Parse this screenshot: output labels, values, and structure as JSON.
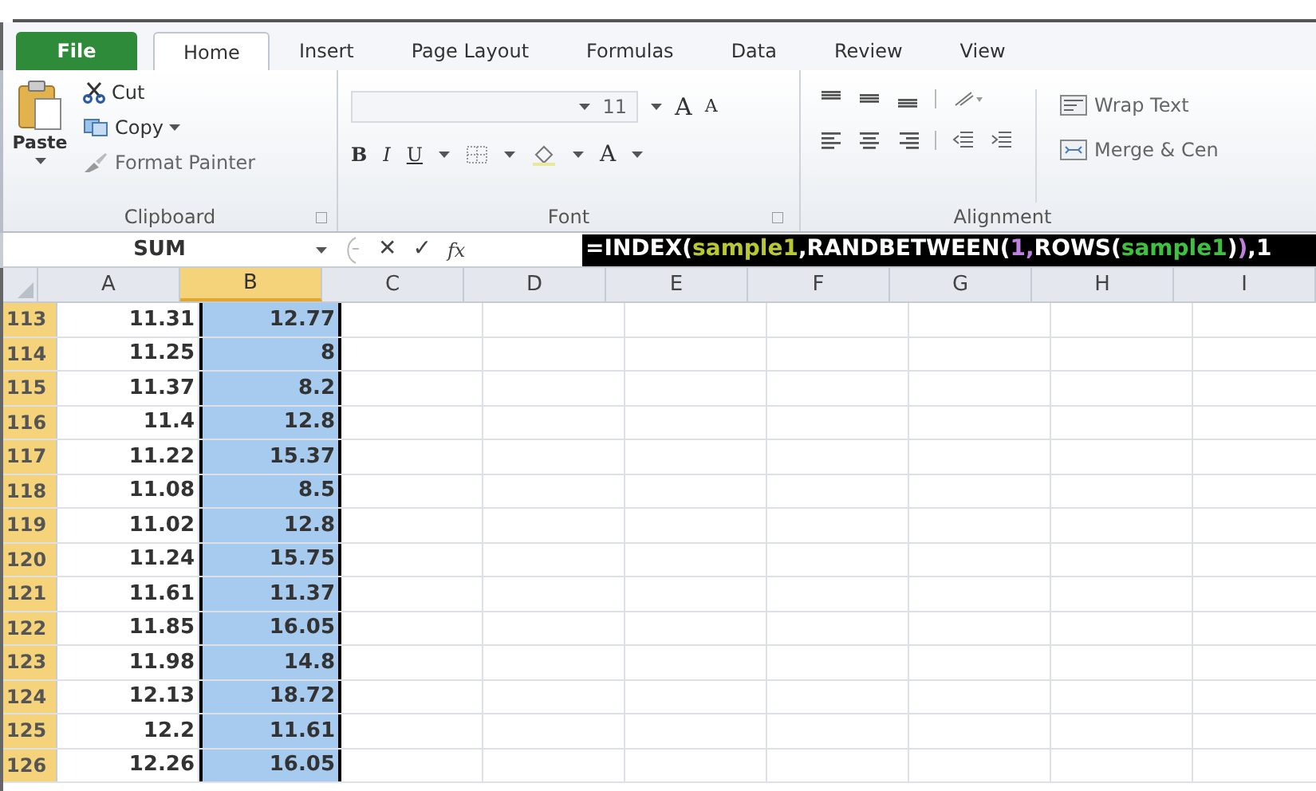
{
  "tabs": [
    {
      "label": "File",
      "kind": "file",
      "selected": false
    },
    {
      "label": "Home",
      "kind": "tab",
      "selected": true
    },
    {
      "label": "Insert",
      "kind": "tab",
      "selected": false
    },
    {
      "label": "Page Layout",
      "kind": "tab",
      "selected": false
    },
    {
      "label": "Formulas",
      "kind": "tab",
      "selected": false
    },
    {
      "label": "Data",
      "kind": "tab",
      "selected": false
    },
    {
      "label": "Review",
      "kind": "tab",
      "selected": false
    },
    {
      "label": "View",
      "kind": "tab",
      "selected": false
    }
  ],
  "clipboard": {
    "paste": "Paste",
    "cut": "Cut",
    "copy": "Copy",
    "format_painter": "Format Painter",
    "label": "Clipboard"
  },
  "font": {
    "size": "11",
    "bold": "B",
    "italic": "I",
    "underline": "U",
    "font_color": "A",
    "grow": "A",
    "shrink": "A",
    "label": "Font"
  },
  "alignment": {
    "wrap_text": "Wrap Text",
    "merge": "Merge & Cen",
    "label": "Alignment"
  },
  "formula_bar": {
    "name_box": "SUM",
    "cancel": "✕",
    "enter": "✓",
    "fx": "fx",
    "formula": [
      {
        "text": "=INDEX(",
        "kind": "plain"
      },
      {
        "text": "sample1",
        "kind": "range"
      },
      {
        "text": ",RANDBETWEEN(",
        "kind": "plain"
      },
      {
        "text": "1,",
        "kind": "nested"
      },
      {
        "text": "ROWS(",
        "kind": "plain"
      },
      {
        "text": "sample1",
        "kind": "inner"
      },
      {
        "text": ")",
        "kind": "plain"
      },
      {
        "text": ")",
        "kind": "nested"
      },
      {
        "text": ",1",
        "kind": "plain"
      }
    ]
  },
  "columns": [
    {
      "label": "A",
      "selected": false
    },
    {
      "label": "B",
      "selected": true
    },
    {
      "label": "C",
      "selected": false
    },
    {
      "label": "D",
      "selected": false
    },
    {
      "label": "E",
      "selected": false
    },
    {
      "label": "F",
      "selected": false
    },
    {
      "label": "G",
      "selected": false
    },
    {
      "label": "H",
      "selected": false
    },
    {
      "label": "I",
      "selected": false
    }
  ],
  "rows": [
    {
      "num": "113",
      "selected": true,
      "cells": [
        "11.31",
        "12.77"
      ]
    },
    {
      "num": "114",
      "selected": true,
      "cells": [
        "11.25",
        "8"
      ]
    },
    {
      "num": "115",
      "selected": true,
      "cells": [
        "11.37",
        "8.2"
      ]
    },
    {
      "num": "116",
      "selected": true,
      "cells": [
        "11.4",
        "12.8"
      ]
    },
    {
      "num": "117",
      "selected": true,
      "cells": [
        "11.22",
        "15.37"
      ]
    },
    {
      "num": "118",
      "selected": true,
      "cells": [
        "11.08",
        "8.5"
      ]
    },
    {
      "num": "119",
      "selected": true,
      "cells": [
        "11.02",
        "12.8"
      ]
    },
    {
      "num": "120",
      "selected": true,
      "cells": [
        "11.24",
        "15.75"
      ]
    },
    {
      "num": "121",
      "selected": true,
      "cells": [
        "11.61",
        "11.37"
      ]
    },
    {
      "num": "122",
      "selected": true,
      "cells": [
        "11.85",
        "16.05"
      ]
    },
    {
      "num": "123",
      "selected": true,
      "cells": [
        "11.98",
        "14.8"
      ]
    },
    {
      "num": "124",
      "selected": true,
      "cells": [
        "12.13",
        "18.72"
      ]
    },
    {
      "num": "125",
      "selected": true,
      "cells": [
        "12.2",
        "11.61"
      ]
    },
    {
      "num": "126",
      "selected": true,
      "cells": [
        "12.26",
        "16.05"
      ]
    }
  ]
}
